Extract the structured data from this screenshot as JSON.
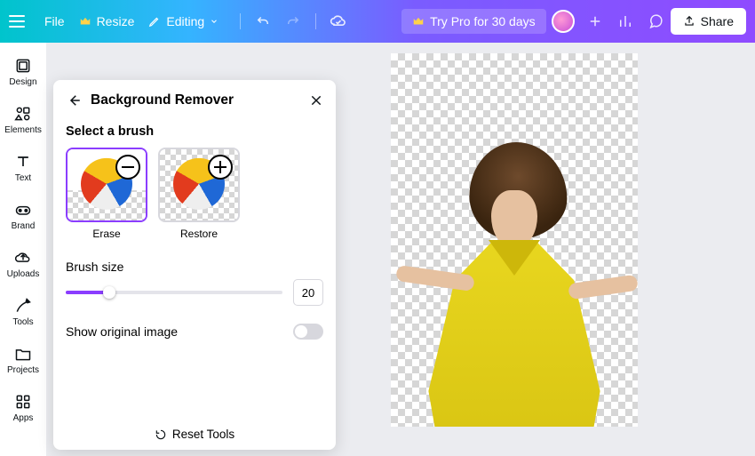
{
  "topbar": {
    "file": "File",
    "resize": "Resize",
    "editing": "Editing",
    "try_pro": "Try Pro for 30 days",
    "share": "Share"
  },
  "sidebar": {
    "items": [
      {
        "label": "Design"
      },
      {
        "label": "Elements"
      },
      {
        "label": "Text"
      },
      {
        "label": "Brand"
      },
      {
        "label": "Uploads"
      },
      {
        "label": "Tools"
      },
      {
        "label": "Projects"
      },
      {
        "label": "Apps"
      }
    ]
  },
  "panel": {
    "title": "Background Remover",
    "select_brush": "Select a brush",
    "brush_erase": "Erase",
    "brush_restore": "Restore",
    "brush_size_label": "Brush size",
    "brush_size_value": "20",
    "slider_percent": 20,
    "show_original": "Show original image",
    "reset": "Reset Tools"
  }
}
